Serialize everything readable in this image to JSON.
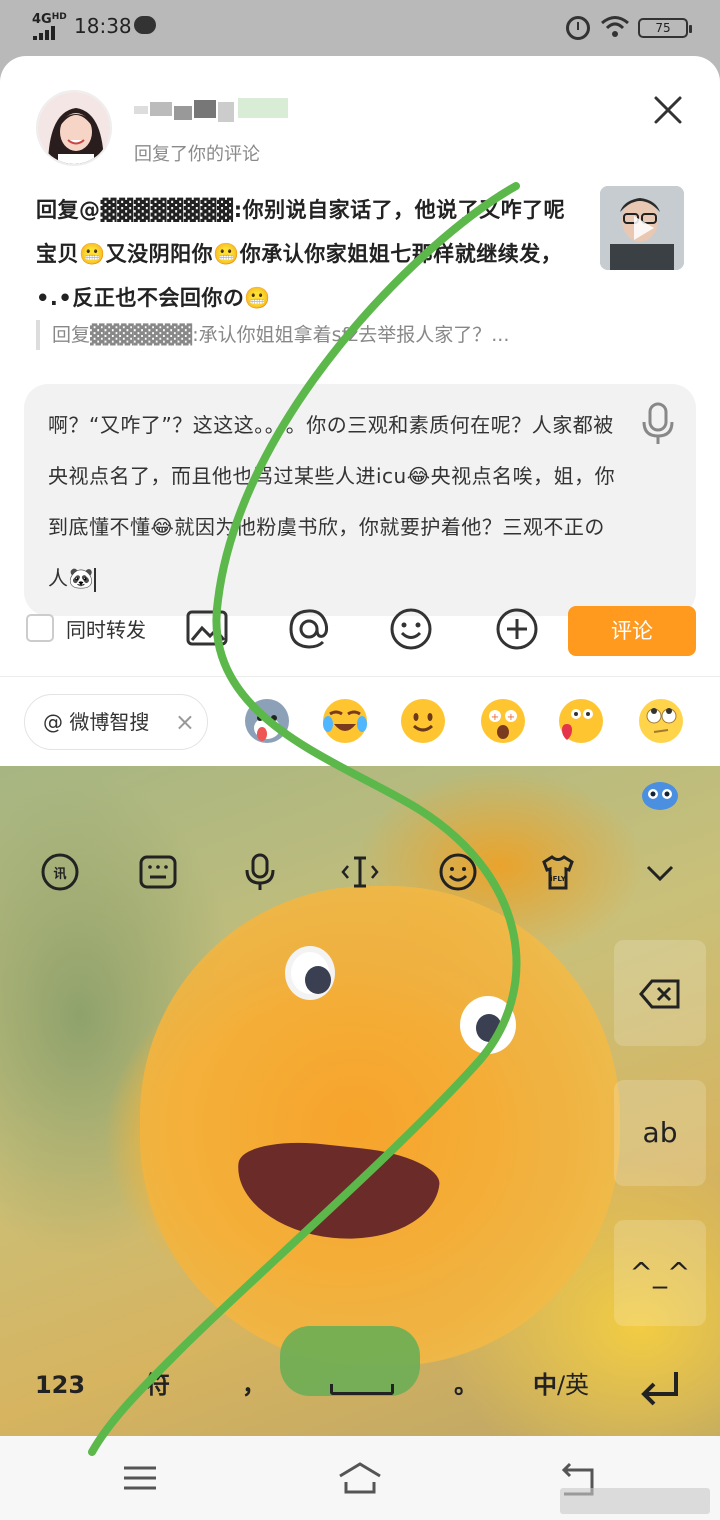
{
  "status_bar": {
    "network": "4G",
    "network_suffix": "HD",
    "time": "18:38",
    "battery": "75"
  },
  "reply_header": {
    "subtitle": "回复了你的评论"
  },
  "reply": {
    "text": "回复@▓▓▓▓▓▓▓▓:你别说自家话了，他说了又咋了呢宝贝😬又没阴阳你😬你承认你家姐姐七那样就继续发，•.•反正也不会回你の😬",
    "quote": "回复▓▓▓▓▓▓▓:承认你姐姐拿着sfz去举报人家了？..."
  },
  "composer": {
    "text": "啊？“又咋了”？这这这。。。。你の三观和素质何在呢？人家都被央视点名了，而且他也骂过某些人进icu😂央视点名唉，姐，你到底懂不懂😂就因为他粉虞书欣，你就要护着他？三观不正の人🐼"
  },
  "toolbar": {
    "repost_label": "同时转发",
    "submit_label": "评论"
  },
  "mention_chip": {
    "label": "@ 微博智搜"
  },
  "emojis": [
    "husky-emoji",
    "laugh-cry-emoji",
    "smile-emoji",
    "star-eyes-emoji",
    "heart-kiss-emoji",
    "eye-roll-emoji"
  ],
  "keyboard": {
    "side_keys": {
      "ab": "ab",
      "kaomoji": "^_^"
    },
    "bottom": {
      "numbers": "123",
      "symbols": "符",
      "comma": "，",
      "period": "。",
      "lang_zh": "中",
      "lang_sep": "/英"
    }
  },
  "colors": {
    "accent": "#ff9a1e",
    "scribble": "#5cb84a"
  }
}
